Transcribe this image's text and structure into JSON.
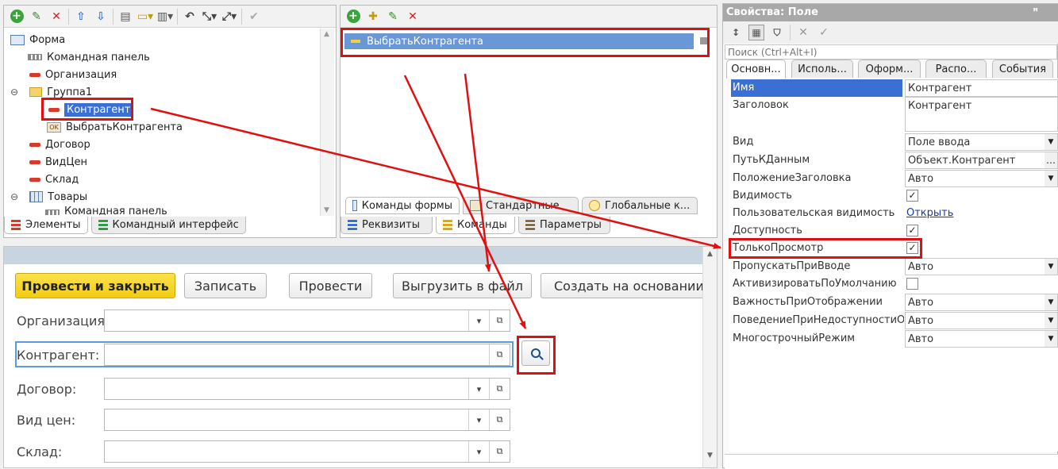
{
  "tree_panel": {
    "items": [
      {
        "label": "Форма",
        "icon": "form-icon"
      },
      {
        "label": "Командная панель",
        "icon": "command-bar-icon"
      },
      {
        "label": "Организация",
        "icon": "field-icon"
      },
      {
        "label": "Группа1",
        "icon": "folder-icon"
      },
      {
        "label": "Контрагент",
        "icon": "field-icon"
      },
      {
        "label": "ВыбратьКонтрагента",
        "icon": "button-ok-icon"
      },
      {
        "label": "Договор",
        "icon": "field-icon"
      },
      {
        "label": "ВидЦен",
        "icon": "field-icon"
      },
      {
        "label": "Склад",
        "icon": "field-icon"
      },
      {
        "label": "Товары",
        "icon": "table-icon"
      },
      {
        "label": "Командная панель",
        "icon": "command-bar-icon"
      }
    ],
    "tabs": [
      "Элементы",
      "Командный интерфейс"
    ],
    "ok_badge": "OK"
  },
  "commands_panel": {
    "item": "ВыбратьКонтрагента",
    "top_tabs": [
      "Команды формы",
      "Стандартные",
      "Глобальные к..."
    ],
    "bottom_tabs": [
      "Реквизиты",
      "Команды",
      "Параметры"
    ]
  },
  "preview": {
    "buttons": {
      "post_close": "Провести и закрыть",
      "save": "Записать",
      "post": "Провести",
      "export": "Выгрузить в файл",
      "create_based": "Создать на основании"
    },
    "fields": {
      "organization": "Организация:",
      "counterparty": "Контрагент:",
      "contract": "Договор:",
      "price_type": "Вид цен:",
      "warehouse": "Склад:"
    }
  },
  "properties": {
    "title": "Свойства: Поле",
    "pin": "ꟸ",
    "search_placeholder": "Поиск (Ctrl+Alt+I)",
    "tabs": [
      "Основн...",
      "Исполь...",
      "Оформ...",
      "Распо...",
      "События"
    ],
    "rows": {
      "name_label": "Имя",
      "name_value": "Контрагент",
      "title_label": "Заголовок",
      "title_value": "Контрагент",
      "view_label": "Вид",
      "view_value": "Поле ввода",
      "path_label": "ПутьКДанным",
      "path_value": "Объект.Контрагент",
      "title_pos_label": "ПоложениеЗаголовка",
      "title_pos_value": "Авто",
      "visibility_label": "Видимость",
      "user_vis_label": "Пользовательская видимость",
      "user_vis_link": "Открыть",
      "enabled_label": "Доступность",
      "readonly_label": "ТолькоПросмотр",
      "skip_label": "ПропускатьПриВводе",
      "skip_value": "Авто",
      "activate_label": "АктивизироватьПоУмолчанию",
      "importance_label": "ВажностьПриОтображении",
      "importance_value": "Авто",
      "unavail_label": "ПоведениеПриНедоступностиО",
      "unavail_value": "Авто",
      "multiline_label": "МногострочныйРежим",
      "multiline_value": "Авто"
    }
  }
}
